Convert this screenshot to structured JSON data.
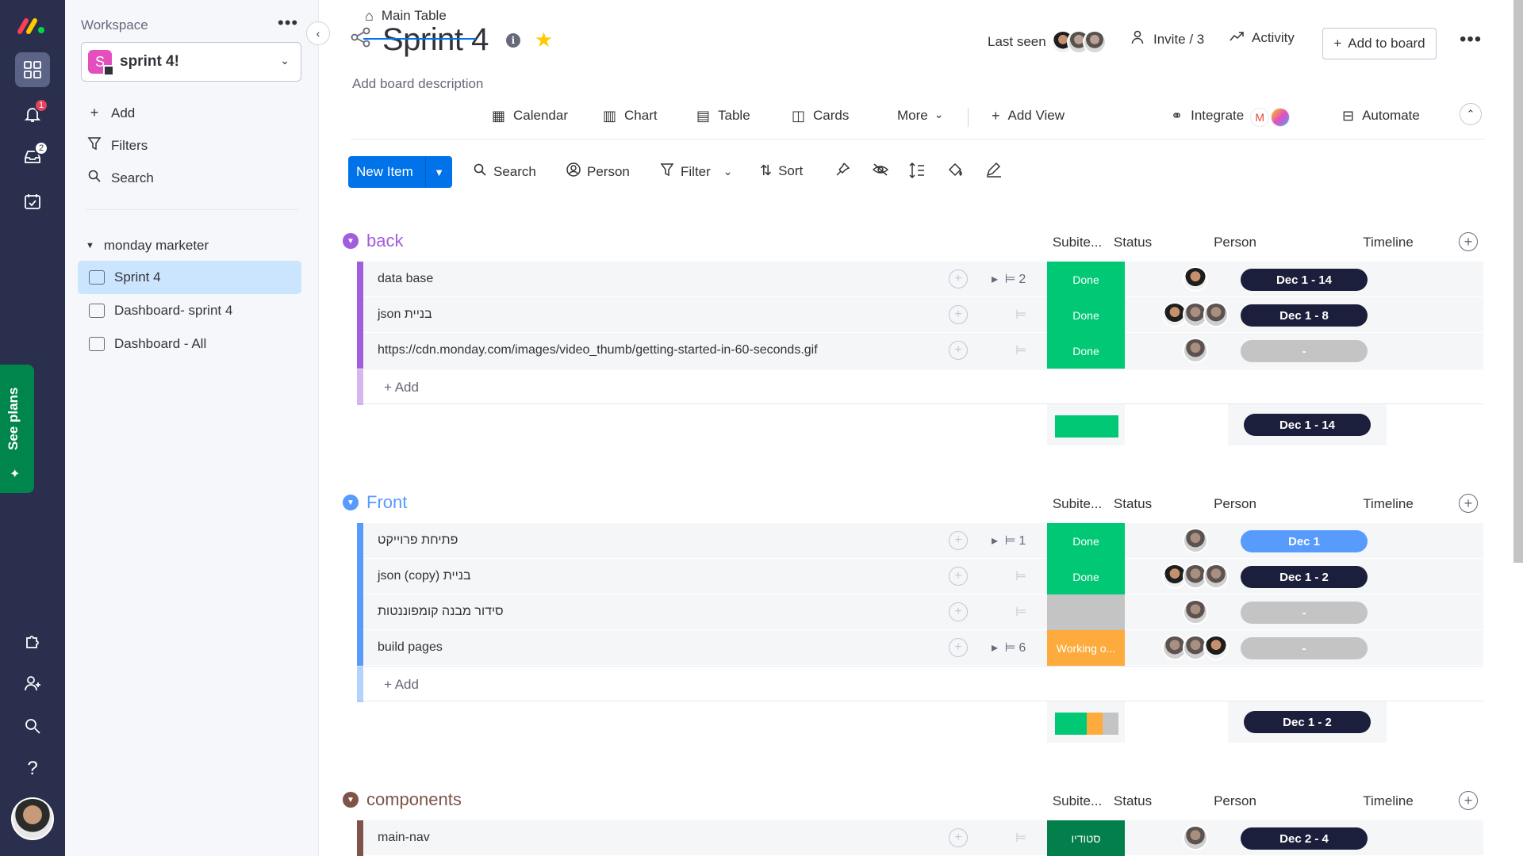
{
  "rail": {
    "badges": {
      "notifications": "1",
      "inbox": "2"
    },
    "see_plans": "See plans"
  },
  "sidebar": {
    "workspace_label": "Workspace",
    "workspace_letter": "S",
    "workspace_name": "sprint 4!",
    "actions": {
      "add": "Add",
      "filters": "Filters",
      "search": "Search"
    },
    "folder": "monday marketer",
    "boards": [
      "Sprint 4",
      "Dashboard- sprint 4",
      "Dashboard - All"
    ]
  },
  "board": {
    "title": "Sprint 4",
    "description": "Add board description",
    "last_seen": "Last seen",
    "invite": "Invite / 3",
    "activity": "Activity",
    "add_to_board": "Add to board"
  },
  "tabs": {
    "main_table": "Main Table",
    "calendar": "Calendar",
    "chart": "Chart",
    "table": "Table",
    "cards": "Cards",
    "more": "More",
    "add_view": "Add View",
    "integrate": "Integrate",
    "automate": "Automate"
  },
  "toolbar": {
    "new_item": "New Item",
    "search": "Search",
    "person": "Person",
    "filter": "Filter",
    "sort": "Sort"
  },
  "columns": {
    "subitems": "Subite...",
    "status": "Status",
    "person": "Person",
    "timeline": "Timeline"
  },
  "add_label": "+ Add",
  "colors": {
    "done": "#00c875",
    "working": "#fdab3d",
    "empty": "#c4c4c4",
    "studio": "#037f4c",
    "timeline_dark": "#1c1f3b",
    "timeline_blue": "#579bfc",
    "back": "#a25ddc",
    "front": "#579bfc",
    "components": "#7f5347"
  },
  "groups": [
    {
      "title": "back",
      "summary_timeline": "Dec 1 - 14",
      "rows": [
        {
          "name": "data base",
          "subitems": "2",
          "status": "Done",
          "timeline": "Dec 1 - 14"
        },
        {
          "name": "json בניית",
          "subitems": "",
          "status": "Done",
          "timeline": "Dec 1 - 8"
        },
        {
          "name": "https://cdn.monday.com/images/video_thumb/getting-started-in-60-seconds.gif",
          "subitems": "",
          "status": "Done",
          "timeline": "-"
        }
      ]
    },
    {
      "title": "Front",
      "summary_timeline": "Dec 1 - 2",
      "rows": [
        {
          "name": "פתיחת פרוייקט",
          "subitems": "1",
          "status": "Done",
          "timeline": "Dec 1"
        },
        {
          "name": "json (copy) בניית",
          "subitems": "",
          "status": "Done",
          "timeline": "Dec 1 - 2"
        },
        {
          "name": "סידור מבנה קומפוננטות",
          "subitems": "",
          "status": "",
          "timeline": "-"
        },
        {
          "name": "build pages",
          "subitems": "6",
          "status": "Working o...",
          "timeline": "-"
        }
      ]
    },
    {
      "title": "components",
      "rows": [
        {
          "name": "main-nav",
          "subitems": "",
          "status": "סטודיו",
          "timeline": "Dec 2 - 4"
        }
      ]
    }
  ]
}
